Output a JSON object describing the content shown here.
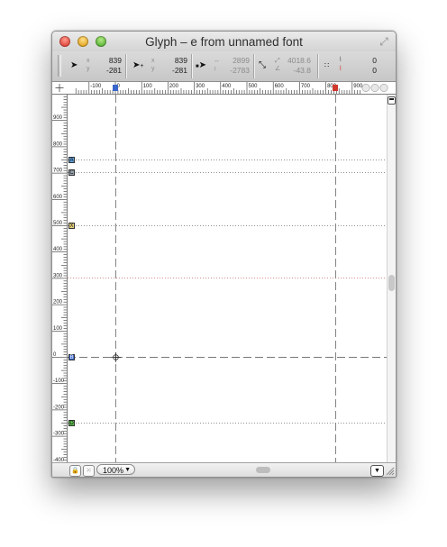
{
  "window": {
    "title": "Glyph – e from unnamed font"
  },
  "toolbar": {
    "pointer": {
      "x_label": "x",
      "y_label": "y",
      "x": "839",
      "y": "-281"
    },
    "pointer2": {
      "x_label": "x",
      "y_label": "y",
      "x": "839",
      "y": "-281"
    },
    "delta": {
      "dx": "2899",
      "dy": "-2783"
    },
    "distance": {
      "length": "4018.6",
      "angle": "-43.8"
    },
    "counts": {
      "top": "0",
      "bottom": "0"
    }
  },
  "ruler_top": {
    "labels": [
      "-100",
      "0",
      "100",
      "200",
      "300",
      "400",
      "500",
      "600",
      "700",
      "800",
      "900"
    ]
  },
  "ruler_left": {
    "labels": [
      "900",
      "800",
      "700",
      "600",
      "500",
      "400",
      "300",
      "200",
      "100",
      "0",
      "-100",
      "-200",
      "-300",
      "-400"
    ]
  },
  "metrics": {
    "ascender": {
      "letter": "A",
      "color": "#5b9bd5"
    },
    "cap_height": {
      "letter": "C",
      "color": "#9aa6b0"
    },
    "x_height": {
      "letter": "X",
      "color": "#e6d27a"
    },
    "baseline": {
      "letter": "B",
      "color": "#3a66cc"
    },
    "descender": {
      "letter": "D",
      "color": "#5cbd4a"
    }
  },
  "bottombar": {
    "zoom": "100%"
  },
  "colors": {
    "guide": "#777777",
    "half_line": "#c76a5e",
    "thumb": "#c8c8c8"
  }
}
